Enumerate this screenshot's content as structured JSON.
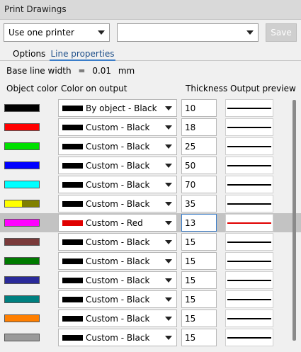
{
  "window": {
    "title": "Print Drawings"
  },
  "toolbar": {
    "printer_mode": "Use one printer",
    "printer_name": "",
    "save_label": "Save"
  },
  "tabs": [
    {
      "label": "Options",
      "active": false
    },
    {
      "label": "Line properties",
      "active": true
    }
  ],
  "base_line": {
    "label": "Base line width",
    "equals": "=",
    "value": "0.01",
    "unit": "mm"
  },
  "columns": {
    "object_color": "Object color",
    "color_on_output": "Color on output",
    "thickness": "Thickness",
    "output_preview": "Output preview"
  },
  "rows": [
    {
      "object_colors": [
        "#000000"
      ],
      "output_label": "By object - Black",
      "output_color": "#000000",
      "thickness": "10",
      "selected": false
    },
    {
      "object_colors": [
        "#ff0000"
      ],
      "output_label": "Custom - Black",
      "output_color": "#000000",
      "thickness": "18",
      "selected": false
    },
    {
      "object_colors": [
        "#00e000"
      ],
      "output_label": "Custom - Black",
      "output_color": "#000000",
      "thickness": "25",
      "selected": false
    },
    {
      "object_colors": [
        "#0000ff"
      ],
      "output_label": "Custom - Black",
      "output_color": "#000000",
      "thickness": "50",
      "selected": false
    },
    {
      "object_colors": [
        "#00ffff"
      ],
      "output_label": "Custom - Black",
      "output_color": "#000000",
      "thickness": "70",
      "selected": false
    },
    {
      "object_colors": [
        "#ffff00",
        "#808000"
      ],
      "output_label": "Custom - Black",
      "output_color": "#000000",
      "thickness": "35",
      "selected": false
    },
    {
      "object_colors": [
        "#ff00ff"
      ],
      "output_label": "Custom - Red",
      "output_color": "#e00000",
      "thickness": "13",
      "selected": true
    },
    {
      "object_colors": [
        "#7a3a3a"
      ],
      "output_label": "Custom - Black",
      "output_color": "#000000",
      "thickness": "15",
      "selected": false
    },
    {
      "object_colors": [
        "#007a00"
      ],
      "output_label": "Custom - Black",
      "output_color": "#000000",
      "thickness": "15",
      "selected": false
    },
    {
      "object_colors": [
        "#2a2a9a"
      ],
      "output_label": "Custom - Black",
      "output_color": "#000000",
      "thickness": "15",
      "selected": false
    },
    {
      "object_colors": [
        "#008080"
      ],
      "output_label": "Custom - Black",
      "output_color": "#000000",
      "thickness": "15",
      "selected": false
    },
    {
      "object_colors": [
        "#ff7f00"
      ],
      "output_label": "Custom - Black",
      "output_color": "#000000",
      "thickness": "15",
      "selected": false
    },
    {
      "object_colors": [
        "#9a9a9a"
      ],
      "output_label": "Custom - Black",
      "output_color": "#000000",
      "thickness": "15",
      "selected": false
    }
  ]
}
